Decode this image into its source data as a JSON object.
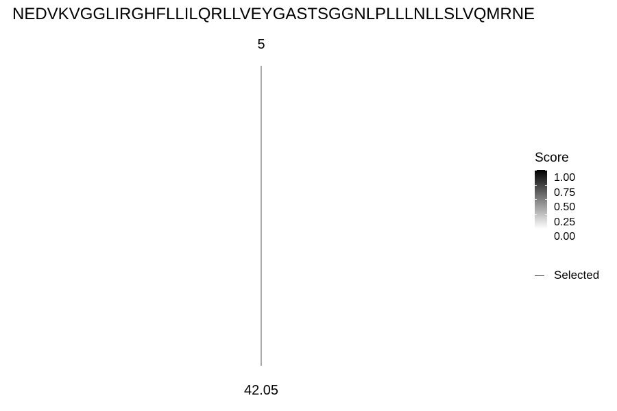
{
  "chart_data": {
    "type": "line",
    "title": "NEDVKVGGLIRGHFLLILQRLLVEYGASTSGGNLPLLLNLLSLVQMRNE",
    "series": [
      {
        "name": "Selected",
        "x": [
          5
        ],
        "y": [
          42.05
        ],
        "color": "#555555"
      }
    ],
    "top_label": "5",
    "bottom_label": "42.05",
    "legend": {
      "title": "Score",
      "ticks": [
        "1.00",
        "0.75",
        "0.50",
        "0.25",
        "0.00"
      ],
      "range": [
        0,
        1
      ],
      "colors": [
        "#ffffff",
        "#000000"
      ],
      "position": "right"
    },
    "grid": false
  }
}
